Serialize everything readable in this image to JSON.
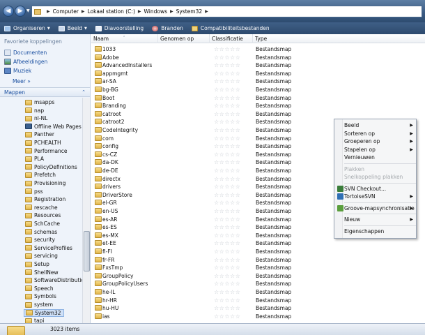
{
  "address": {
    "breadcrumbs": [
      "Computer",
      "Lokaal station (C:)",
      "Windows",
      "System32"
    ]
  },
  "toolbar": {
    "organize": "Organiseren",
    "view": "Beeld",
    "slideshow": "Diavoorstelling",
    "burn": "Branden",
    "compat": "Compatibiliteitsbestanden"
  },
  "nav": {
    "favorites_title": "Favoriete koppelingen",
    "favorites": [
      "Documenten",
      "Afbeeldingen",
      "Muziek"
    ],
    "more": "Meer",
    "folders_title": "Mappen",
    "tree": [
      "msapps",
      "nap",
      "nl-NL",
      "Offline Web Pages",
      "Panther",
      "PCHEALTH",
      "Performance",
      "PLA",
      "PolicyDefinitions",
      "Prefetch",
      "Provisioning",
      "pss",
      "Registration",
      "rescache",
      "Resources",
      "SchCache",
      "schemas",
      "security",
      "ServiceProfiles",
      "servicing",
      "Setup",
      "ShellNew",
      "SoftwareDistribution",
      "Speech",
      "Symbols",
      "system",
      "System32",
      "tapi"
    ],
    "selected": "System32",
    "scroll_fraction": 0.72
  },
  "columns": {
    "name": "Naam",
    "tags": "Genomen op",
    "rating": "Classificatie",
    "type": "Type"
  },
  "files": [
    "1033",
    "Adobe",
    "AdvancedInstallers",
    "appmgmt",
    "ar-SA",
    "bg-BG",
    "Boot",
    "Branding",
    "catroot",
    "catroot2",
    "CodeIntegrity",
    "com",
    "config",
    "cs-CZ",
    "da-DK",
    "de-DE",
    "directx",
    "drivers",
    "DriverStore",
    "el-GR",
    "en-US",
    "es-AR",
    "es-ES",
    "es-MX",
    "et-EE",
    "fi-FI",
    "fr-FR",
    "FxsTmp",
    "GroupPolicy",
    "GroupPolicyUsers",
    "he-IL",
    "hr-HR",
    "hu-HU",
    "ias"
  ],
  "file_type": "Bestandsmap",
  "rating_stars": "☆☆☆☆☆",
  "context_menu": [
    {
      "label": "Beeld",
      "sub": true
    },
    {
      "label": "Sorteren op",
      "sub": true
    },
    {
      "label": "Groeperen op",
      "sub": true
    },
    {
      "label": "Stapelen op",
      "sub": true
    },
    {
      "label": "Vernieuwen",
      "sub": false
    },
    {
      "sep": true
    },
    {
      "label": "Plakken",
      "disabled": true
    },
    {
      "label": "Snelkoppeling plakken",
      "disabled": true
    },
    {
      "sep": true
    },
    {
      "label": "SVN Checkout...",
      "icon": "svn-icon"
    },
    {
      "label": "TortoiseSVN",
      "sub": true,
      "icon": "tortoise-icon"
    },
    {
      "sep": true
    },
    {
      "label": "Groove-mapsynchronisatie",
      "sub": true,
      "icon": "groove-icon"
    },
    {
      "sep": true
    },
    {
      "label": "Nieuw",
      "sub": true
    },
    {
      "sep": true
    },
    {
      "label": "Eigenschappen"
    }
  ],
  "status": {
    "count": "3023 items"
  },
  "colors": {
    "link": "#1a4fa0",
    "chrome_dark": "#2d4a6e",
    "folder": "#e1b54a"
  }
}
